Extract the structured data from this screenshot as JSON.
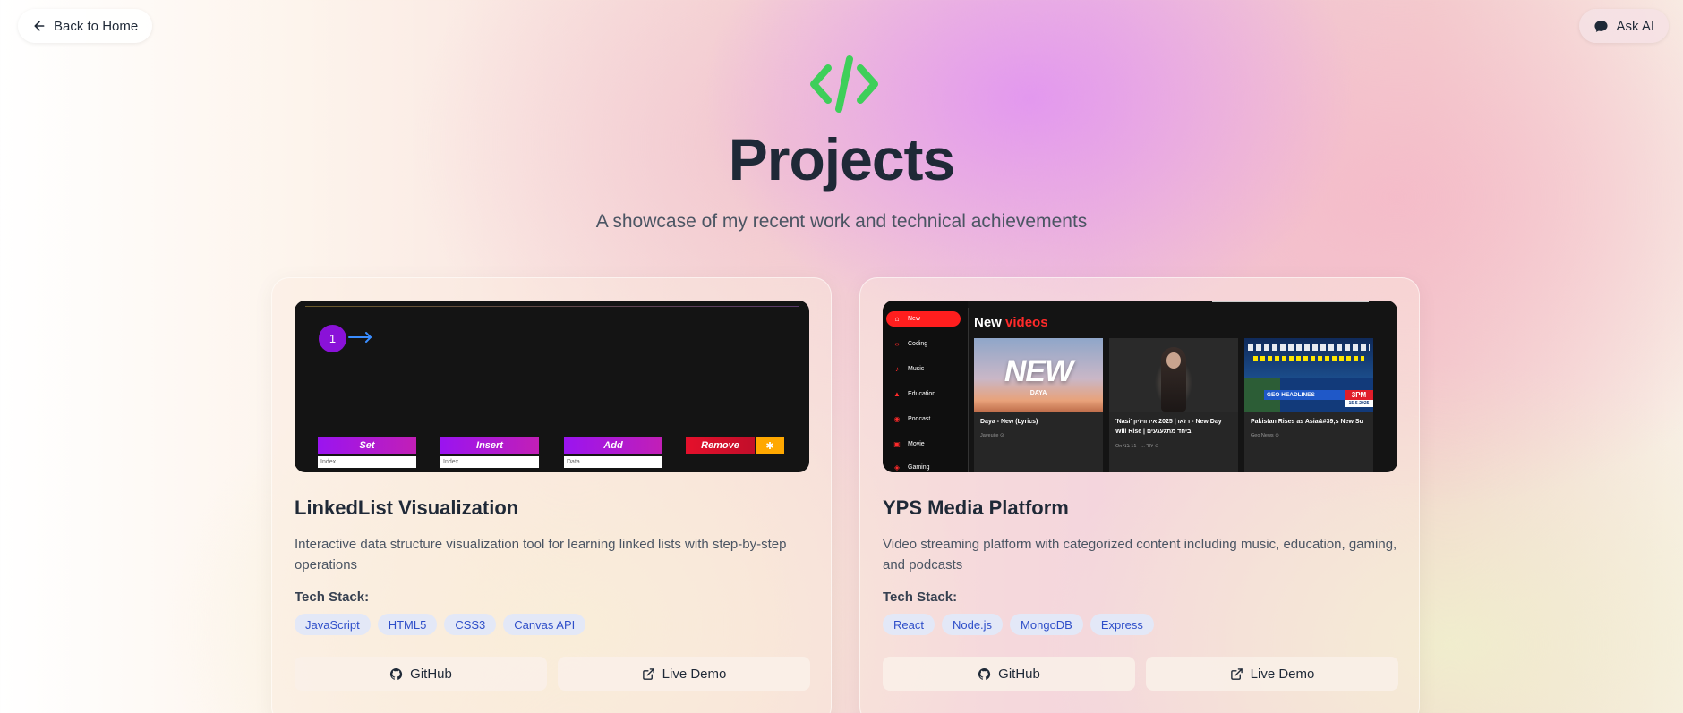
{
  "nav": {
    "back_label": "Back to Home",
    "ask_label": "Ask AI"
  },
  "hero": {
    "title": "Projects",
    "subtitle": "A showcase of my recent work and technical achievements",
    "icon": "code-icon",
    "icon_color": "#3ecf5a"
  },
  "projects": [
    {
      "title": "LinkedList Visualization",
      "description": "Interactive data structure visualization tool for learning linked lists with step-by-step operations",
      "stack_label": "Tech Stack:",
      "tech": [
        "JavaScript",
        "HTML5",
        "CSS3",
        "Canvas API"
      ],
      "github_label": "GitHub",
      "demo_label": "Live Demo",
      "preview": {
        "node_value": "1",
        "ops": [
          "Set",
          "Insert",
          "Add"
        ],
        "placeholders": [
          "Index",
          "Index",
          "Data"
        ],
        "remove_label": "Remove",
        "gear_icon": "gear-icon"
      }
    },
    {
      "title": "YPS Media Platform",
      "description": "Video streaming platform with categorized content including music, education, gaming, and podcasts",
      "stack_label": "Tech Stack:",
      "tech": [
        "React",
        "Node.js",
        "MongoDB",
        "Express"
      ],
      "github_label": "GitHub",
      "demo_label": "Live Demo",
      "preview": {
        "sidebar": [
          "New",
          "Coding",
          "Music",
          "Education",
          "Podcast",
          "Movie",
          "Gaming"
        ],
        "heading_white": "New",
        "heading_red": "videos",
        "videos": [
          {
            "thumb_text": "NEW",
            "thumb_sub": "DAYA",
            "title": "Daya - New (Lyrics)",
            "meta": "Javeuite ⊙"
          },
          {
            "title": "'Nasi' רזאו | 2025 אירוויזיון - New Day Will Rise | ביחד מתגעגעים",
            "meta": "On יחד ... · 11 בני ⊙"
          },
          {
            "thumb_headline": "GEO HEADLINES",
            "thumb_time": "3PM",
            "thumb_date": "15-5-2025",
            "title": "Pakistan Rises as Asia&#39;s New Su",
            "meta": "Geo News ⊙"
          }
        ]
      }
    }
  ]
}
